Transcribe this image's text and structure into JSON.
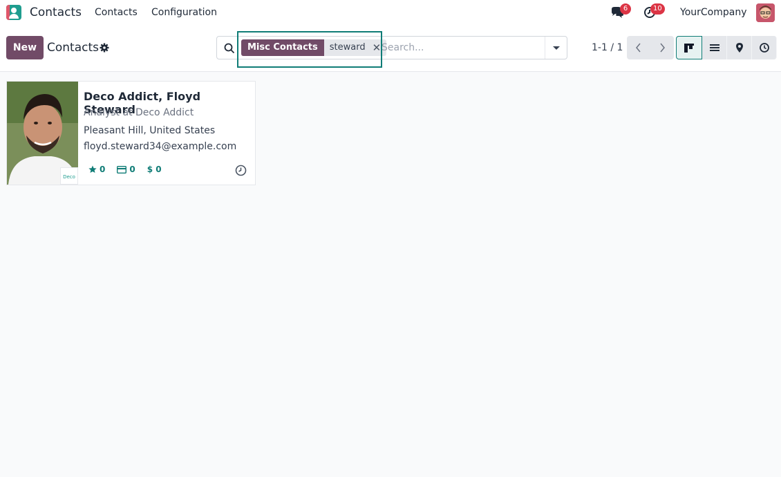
{
  "navbar": {
    "app_name": "Contacts",
    "menu": [
      "Contacts",
      "Configuration"
    ],
    "messages_badge": "6",
    "activities_badge": "10",
    "company": "YourCompany"
  },
  "control_panel": {
    "new_label": "New",
    "breadcrumb": "Contacts",
    "search": {
      "facet_label": "Misc Contacts",
      "facet_value": "steward",
      "placeholder": "Search..."
    },
    "pager": "1-1 / 1"
  },
  "card": {
    "name": "Deco Addict, Floyd Steward",
    "function": "Analyst at Deco Addict",
    "location": "Pleasant Hill, United States",
    "email": "floyd.steward34@example.com",
    "company_logo_text": "Deco",
    "stats": {
      "opportunities": "0",
      "invoices": "0",
      "sales": "$ 0"
    }
  },
  "colors": {
    "brand": "#714b67",
    "accent": "#0f7c76",
    "badge": "#dc3545"
  },
  "icons": [
    "search-icon",
    "gear-icon",
    "chat-icon",
    "clock-icon",
    "kanban-icon",
    "list-icon",
    "map-icon",
    "activity-icon",
    "star-icon",
    "card-icon"
  ]
}
